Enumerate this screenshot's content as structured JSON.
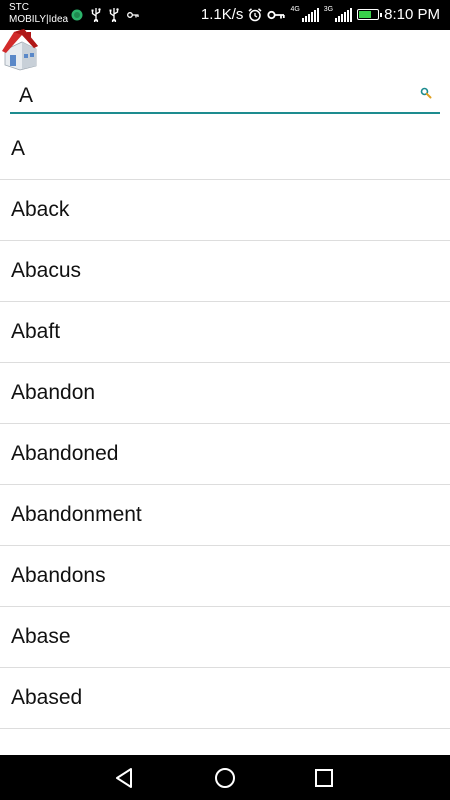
{
  "status_bar": {
    "carrier_line1": "STC",
    "carrier_line2": "MOBILY|Idea",
    "net_speed": "1.1K/s",
    "sim1_label": "4G",
    "sim2_label": "3G",
    "time": "8:10 PM",
    "icons": [
      "whatsapp-dot-icon",
      "usb-icon",
      "usb-icon",
      "key-icon",
      "alarm-icon",
      "vpn-key-icon",
      "signal-icon",
      "signal-icon",
      "battery-charging-icon"
    ],
    "battery_fill_fraction": 0.7
  },
  "header": {
    "icon": "home-icon"
  },
  "search": {
    "value": "A",
    "placeholder": "",
    "icon": "search-icon",
    "accent": "#1d8c8f"
  },
  "words": [
    "A",
    "Aback",
    "Abacus",
    "Abaft",
    "Abandon",
    "Abandoned",
    "Abandonment",
    "Abandons",
    "Abase",
    "Abased",
    ""
  ],
  "nav": {
    "icons": [
      "back-icon",
      "home-circle-icon",
      "recents-icon"
    ]
  }
}
